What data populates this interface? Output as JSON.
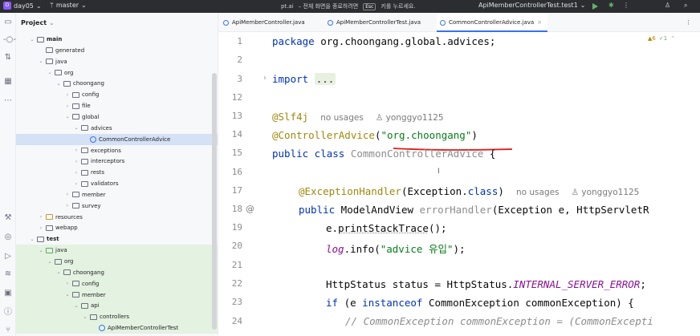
{
  "titlebar": {
    "project": "day05",
    "project_badge": "D",
    "branch": "master",
    "center_title": "pt.ai",
    "center_hint_pre": "– 전체 화면을 종료하려면",
    "center_key": "Esc",
    "center_hint_post": "키를 누르세요.",
    "run_config": "ApiMemberControllerTest.test1"
  },
  "project_panel": {
    "title": "Project",
    "tree": [
      {
        "label": "main",
        "depth": 1,
        "type": "folder",
        "open": true,
        "bold": true
      },
      {
        "label": "generated",
        "depth": 2,
        "type": "folder",
        "open": false,
        "nochev": true
      },
      {
        "label": "java",
        "depth": 2,
        "type": "folder",
        "open": true
      },
      {
        "label": "org",
        "depth": 3,
        "type": "folder",
        "open": true
      },
      {
        "label": "choongang",
        "depth": 4,
        "type": "folder",
        "open": true
      },
      {
        "label": "config",
        "depth": 5,
        "type": "folder",
        "open": false
      },
      {
        "label": "file",
        "depth": 5,
        "type": "folder",
        "open": false
      },
      {
        "label": "global",
        "depth": 5,
        "type": "folder",
        "open": true
      },
      {
        "label": "advices",
        "depth": 6,
        "type": "folder",
        "open": true
      },
      {
        "label": "CommonControllerAdvice",
        "depth": 7,
        "type": "class",
        "selected": true
      },
      {
        "label": "exceptions",
        "depth": 6,
        "type": "folder",
        "open": false
      },
      {
        "label": "interceptors",
        "depth": 6,
        "type": "folder",
        "open": false
      },
      {
        "label": "rests",
        "depth": 6,
        "type": "folder",
        "open": false
      },
      {
        "label": "validators",
        "depth": 6,
        "type": "folder",
        "open": false
      },
      {
        "label": "member",
        "depth": 5,
        "type": "folder",
        "open": false
      },
      {
        "label": "survey",
        "depth": 5,
        "type": "folder",
        "open": false
      },
      {
        "label": "resources",
        "depth": 2,
        "type": "res",
        "open": false
      },
      {
        "label": "webapp",
        "depth": 2,
        "type": "folder",
        "open": false
      },
      {
        "label": "test",
        "depth": 1,
        "type": "folder",
        "open": true,
        "bold": true
      },
      {
        "label": "java",
        "depth": 2,
        "type": "test",
        "open": true,
        "green": true
      },
      {
        "label": "org",
        "depth": 3,
        "type": "folder",
        "open": true,
        "green": true
      },
      {
        "label": "choongang",
        "depth": 4,
        "type": "folder",
        "open": true,
        "green": true
      },
      {
        "label": "config",
        "depth": 5,
        "type": "folder",
        "open": false,
        "green": true
      },
      {
        "label": "member",
        "depth": 5,
        "type": "folder",
        "open": true,
        "green": true
      },
      {
        "label": "api",
        "depth": 6,
        "type": "folder",
        "open": true,
        "green": true
      },
      {
        "label": "controllers",
        "depth": 7,
        "type": "folder",
        "open": true,
        "green": true
      },
      {
        "label": "ApiMemberControllerTest",
        "depth": 8,
        "type": "class",
        "green": true
      }
    ]
  },
  "tabs": [
    {
      "label": "ApiMemberController.java",
      "active": false
    },
    {
      "label": "ApiMemberControllerTest.java",
      "active": false
    },
    {
      "label": "CommonControllerAdvice.java",
      "active": true
    }
  ],
  "warnings": {
    "warn_count": "6",
    "info_count": "1"
  },
  "code": {
    "line_numbers": [
      "1",
      "2",
      "3",
      "12",
      "13",
      "14",
      "15",
      "16",
      "17",
      "18",
      "19",
      "20",
      "21",
      "22",
      "23",
      "24"
    ],
    "pkg_kw": "package",
    "pkg_name": " org.choongang.global.advices;",
    "import_kw": "import",
    "import_fold": "...",
    "slf4j": "@Slf4j",
    "no_usages": "no usages",
    "author": "yonggyo1125",
    "ca_ann": "@ControllerAdvice",
    "ca_open": "(",
    "ca_str": "\"org.choongang\"",
    "ca_close": ")",
    "class_kw": "public class",
    "class_name": " CommonControllerAdvice",
    "class_brace": " {",
    "cursor": "I",
    "eh_ann": "@ExceptionHandler",
    "eh_args": "(Exception.",
    "eh_class": "class",
    "eh_close": ")",
    "eh_no_usages": "no usages",
    "eh_author": "yonggyo1125",
    "m_public": "public",
    "m_sig": " ModelAndView ",
    "m_name": "errorHandler",
    "m_params": "(Exception e, HttpServletR",
    "l19_a": "e.",
    "l19_b": "printStackTrace",
    "l19_c": "();",
    "l20_log": "log",
    "l20_b": ".info(",
    "l20_str": "\"advice 유입\"",
    "l20_c": ");",
    "l22_a": "HttpStatus status = HttpStatus.",
    "l22_b": "INTERNAL_SERVER_ERROR",
    "l22_c": ";",
    "l23_if": "if",
    "l23_a": " (e ",
    "l23_inst": "instanceof",
    "l23_b": " CommonException commonException) {",
    "l24": "// CommonException commonException = (CommonExcepti"
  },
  "colors": {
    "accent": "#3574f0",
    "underline": "#e01e1e",
    "test_green_bg": "#e4f2e1",
    "selected_bg": "#d5e1f5"
  }
}
